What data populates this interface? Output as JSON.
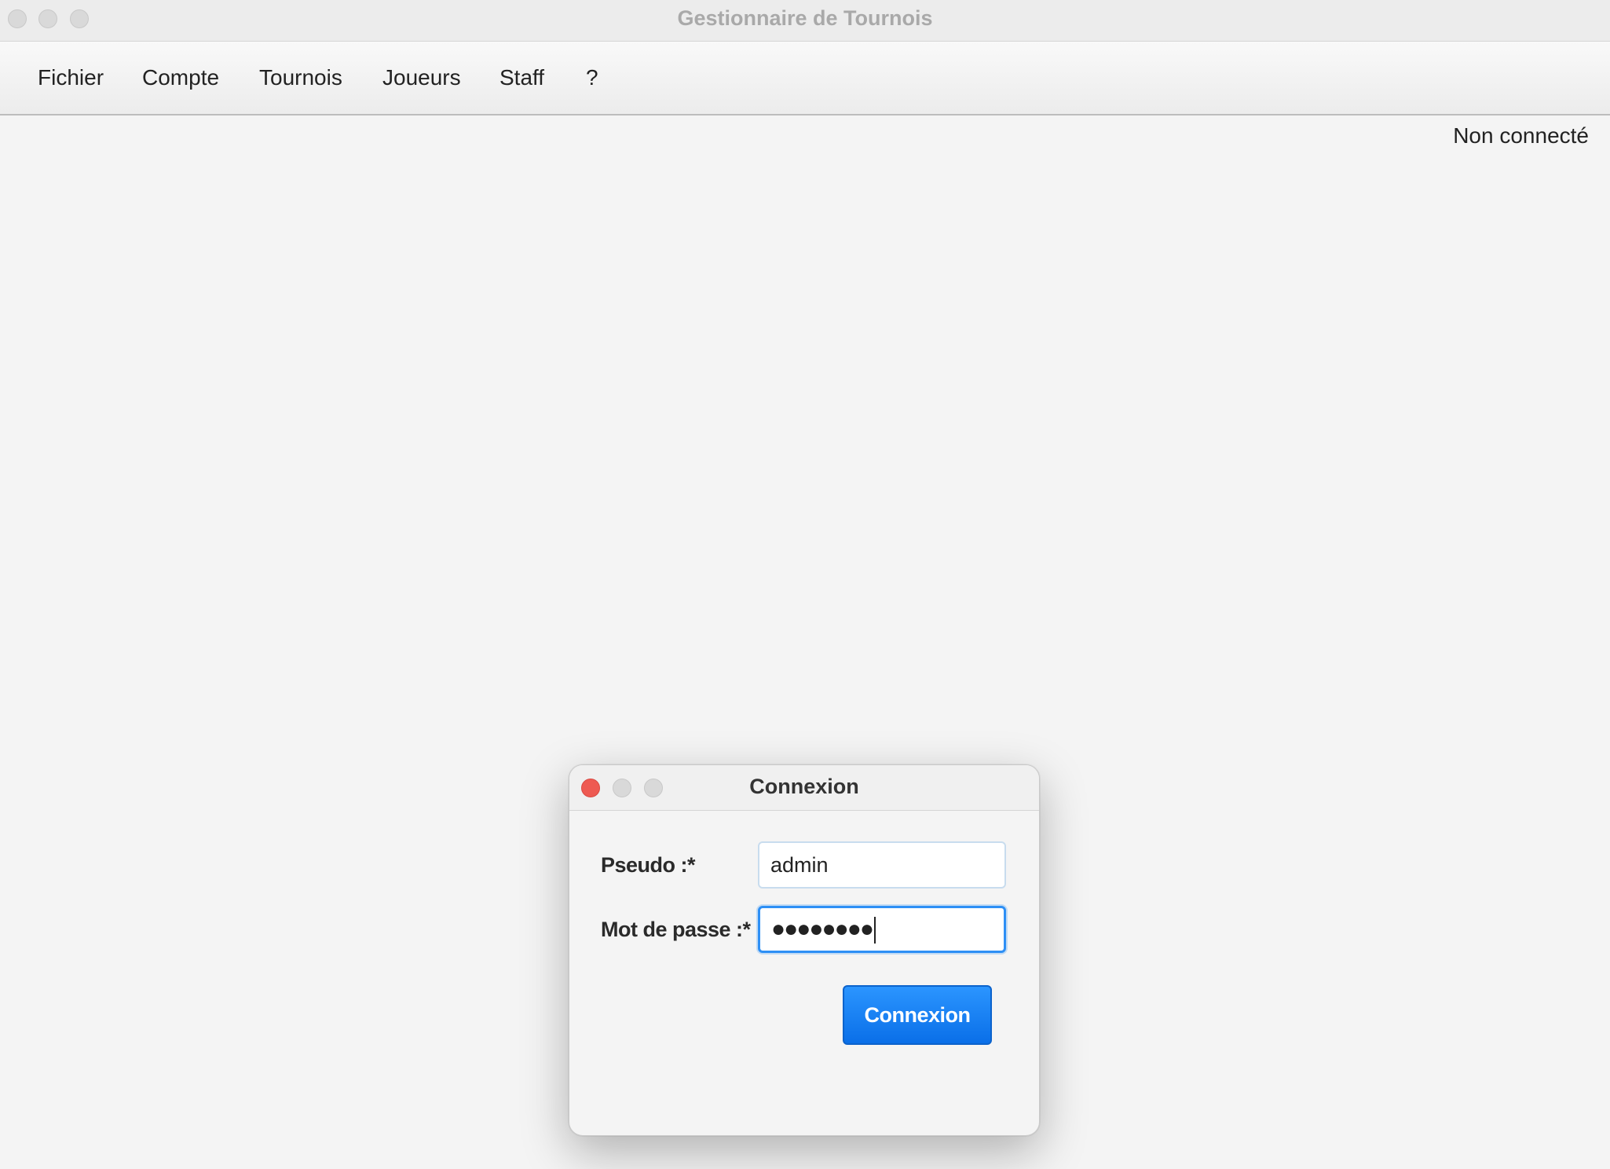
{
  "window": {
    "title": "Gestionnaire de Tournois"
  },
  "menubar": {
    "items": [
      {
        "label": "Fichier"
      },
      {
        "label": "Compte"
      },
      {
        "label": "Tournois"
      },
      {
        "label": "Joueurs"
      },
      {
        "label": "Staff"
      },
      {
        "label": "?"
      }
    ]
  },
  "status": {
    "text": "Non connecté"
  },
  "dialog": {
    "title": "Connexion",
    "pseudo_label": "Pseudo :*",
    "pseudo_value": "admin",
    "password_label": "Mot de passe :*",
    "password_value": "●●●●●●●●",
    "submit_label": "Connexion"
  },
  "colors": {
    "accent": "#0a6fe8",
    "close": "#ee5a52"
  }
}
